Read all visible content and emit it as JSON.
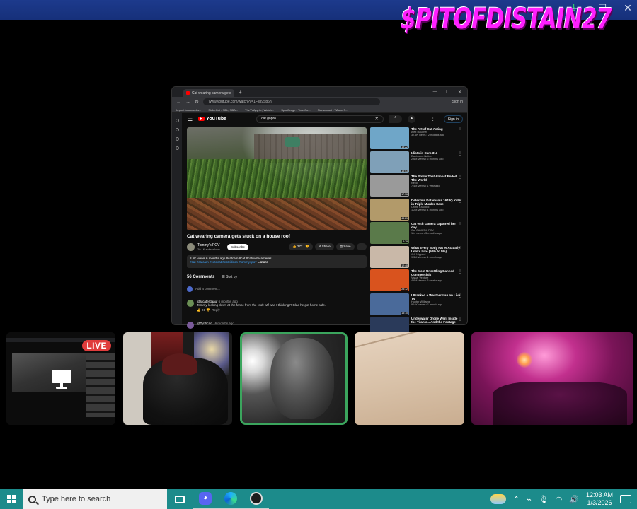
{
  "overlay_text": "$PITOFDISTAIN27",
  "window_controls": {
    "minimize": "—",
    "maximize": "☐",
    "close": "✕"
  },
  "browser": {
    "tab_title": "Cat wearing camera gets st",
    "url": "www.youtube.com/watch?v=1Fkp9Sb6h",
    "signin_mini": "Sign in",
    "bookmarks": [
      "Import bookmarks...",
      "StrikeOut - NBL, NBA...",
      "TheTVApp.to | Watch...",
      "SportSurge - Your Co...",
      "Streameast - Where S..."
    ],
    "youtube": {
      "logo": "YouTube",
      "search_query": "cat gopro",
      "signin_label": "Sign in",
      "video_title": "Cat wearing camera gets stuck on a house roof",
      "channel_name": "Tommy's POV",
      "subscribers": "20.1K subscribers",
      "subscribe_label": "Subscribe",
      "likes": "272",
      "share_label": "Share",
      "save_label": "Save",
      "description_line1": "8.5K views  6 months ago  #catcam #cat #catswithcameras",
      "description_line2": "#cat #catcam #cutecat #catvideos #tommyspov",
      "more_label": "...more",
      "comments_count": "56 Comments",
      "sort_by": "Sort by",
      "add_comment_placeholder": "Add a comment...",
      "comment": {
        "user": "@lucaterdaauf",
        "time": "6 months ago",
        "body": "Tommy looking down at the fence from the roof: wtf was I thinking?! Glad he got home safe.",
        "likes": "31",
        "reply_label": "Reply"
      },
      "comment2_user": "@Tyrdicad",
      "comment2_time": "6 months ago",
      "recommendations": [
        {
          "title": "The Art of Cat Acting",
          "channel": "Alex Raucher",
          "views": "32.5K views • 2 months ago",
          "duration": "13:22",
          "color": "#6fa6c8"
        },
        {
          "title": "Idiots in Cars 313",
          "channel": "Danimann Nation",
          "views": "2.6M views • 6 months ago",
          "duration": "15:03",
          "color": "#7fa0b8"
        },
        {
          "title": "The Storm That Almost Ended The World",
          "channel": "Nexo",
          "views": "7.4M views • 1 year ago",
          "duration": "17:36",
          "color": "#9a9a9a"
        },
        {
          "title": "Detective Dataman's 164 IQ Killer in Triple Murder Case",
          "channel": "Crime Cracked",
          "views": "1.2M views • 4 months ago",
          "duration": "43:21",
          "color": "#b29a6a"
        },
        {
          "title": "Cat with camera captured her day",
          "channel": "Cat CAMERA POV",
          "views": "114 views • 3 months ago",
          "duration": "4:29",
          "color": "#5a7a4a"
        },
        {
          "title": "What Every Body Fat % Actually Looks Like (50% to 5%)",
          "channel": "Jeff Nippard",
          "views": "9.3M views • 1 month ago",
          "duration": "12:48",
          "color": "#c9b8a8"
        },
        {
          "title": "The Most Unsettling Banned Commercials",
          "channel": "Visual Venture",
          "views": "4.6M views • 3 weeks ago",
          "duration": "28:12",
          "color": "#d9531e"
        },
        {
          "title": "I Pranked a Weatherman on Live TV",
          "channel": "Hunter Williams",
          "views": "914K views • 1 month ago",
          "duration": "15:10",
          "color": "#4a6a9a"
        },
        {
          "title": "Underwater Drone Went Inside the Titanic... And the Footage",
          "channel": "",
          "views": "",
          "duration": "",
          "color": "#2a3a5a"
        }
      ]
    }
  },
  "live_badge": "LIVE",
  "taskbar": {
    "search_placeholder": "Type here to search",
    "time": "12:03 AM",
    "date": "1/3/2026"
  }
}
